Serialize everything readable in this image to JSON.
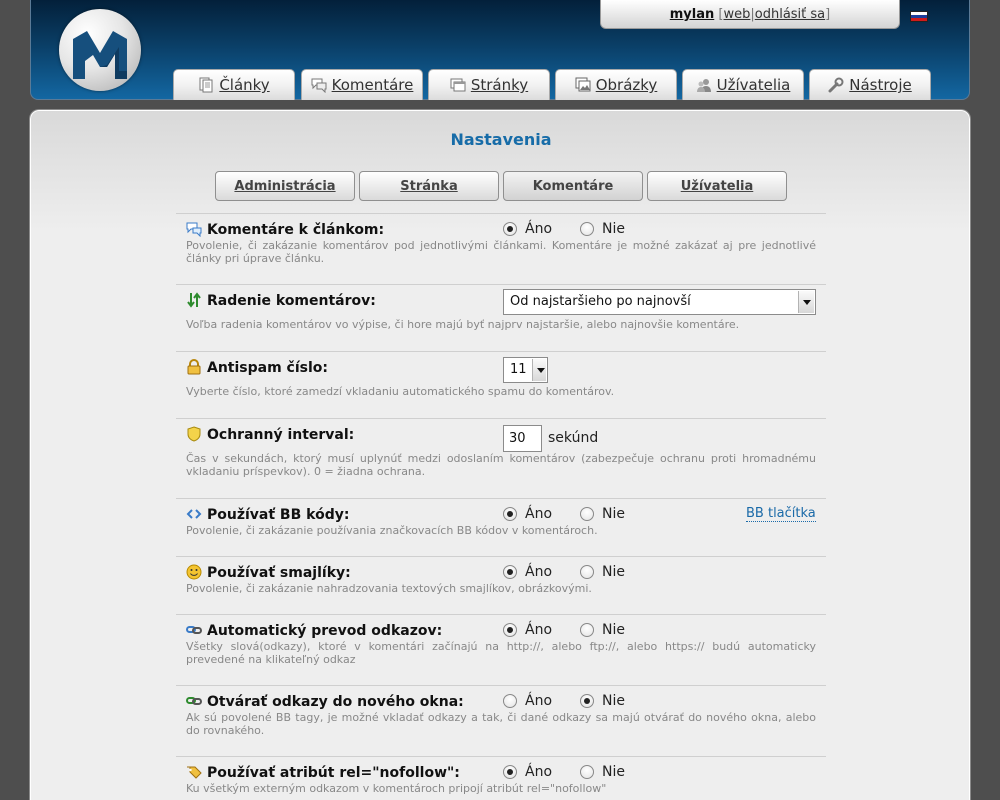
{
  "user": {
    "name": "mylan",
    "web_label": "web",
    "logout_label": "odhlásiť sa"
  },
  "nav_tabs": [
    {
      "label": "Články",
      "icon": "articles-icon"
    },
    {
      "label": "Komentáre",
      "icon": "comments-icon"
    },
    {
      "label": "Stránky",
      "icon": "pages-icon"
    },
    {
      "label": "Obrázky",
      "icon": "images-icon"
    },
    {
      "label": "Užívatelia",
      "icon": "users-icon"
    },
    {
      "label": "Nástroje",
      "icon": "wrench-icon"
    }
  ],
  "page_title": "Nastavenia",
  "sub_tabs": [
    {
      "label": "Administrácia"
    },
    {
      "label": "Stránka"
    },
    {
      "label": "Komentáre",
      "active": true
    },
    {
      "label": "Užívatelia"
    }
  ],
  "settings": {
    "comments_on_articles": {
      "title": "Komentáre k článkom:",
      "desc": "Povolenie, či zakázanie komentárov pod jednotlivými článkami. Komentáre je možné zakázať aj pre jednotlivé články pri úprave článku.",
      "yes_label": "Áno",
      "no_label": "Nie",
      "value": "Áno"
    },
    "comment_order": {
      "title": "Radenie komentárov:",
      "desc": "Voľba radenia komentárov vo výpise, či hore majú byť najprv najstaršie, alebo najnovšie komentáre.",
      "selected": "Od najstaršieho po najnovší"
    },
    "antispam": {
      "title": "Antispam číslo:",
      "desc": "Vyberte číslo, ktoré zamedzí vkladaniu automatického spamu do komentárov.",
      "selected": "11"
    },
    "protect_interval": {
      "title": "Ochranný interval:",
      "desc": "Čas v sekundách, ktorý musí uplynúť medzi odoslaním komentárov (zabezpečuje ochranu proti hromadnému vkladaniu príspevkov). 0 = žiadna ochrana.",
      "value": "30",
      "unit": "sekúnd"
    },
    "bb_codes": {
      "title": "Používať BB kódy:",
      "desc": "Povolenie, či zakázanie používania značkovacích BB kódov v komentároch.",
      "yes_label": "Áno",
      "no_label": "Nie",
      "value": "Áno",
      "link_label": "BB tlačítka"
    },
    "smileys": {
      "title": "Používať smajlíky:",
      "desc": "Povolenie, či zakázanie nahradzovania textových smajlíkov, obrázkovými.",
      "yes_label": "Áno",
      "no_label": "Nie",
      "value": "Áno"
    },
    "auto_links": {
      "title": "Automatický prevod odkazov:",
      "desc": "Všetky slová(odkazy), ktoré v komentári začínajú na http://, alebo ftp://, alebo https:// budú automaticky prevedené na klikateľný odkaz",
      "yes_label": "Áno",
      "no_label": "Nie",
      "value": "Áno"
    },
    "new_window": {
      "title": "Otvárať odkazy do nového okna:",
      "desc": "Ak sú povolené BB tagy, je možné vkladať odkazy a tak, či dané odkazy sa majú otvárať do nového okna, alebo do rovnakého.",
      "yes_label": "Áno",
      "no_label": "Nie",
      "value": "Nie"
    },
    "nofollow": {
      "title": "Používať atribút rel=\"nofollow\":",
      "desc": "Ku všetkým externým odkazom v komentároch pripojí atribút rel=\"nofollow\"",
      "yes_label": "Áno",
      "no_label": "Nie",
      "value": "Áno"
    }
  }
}
